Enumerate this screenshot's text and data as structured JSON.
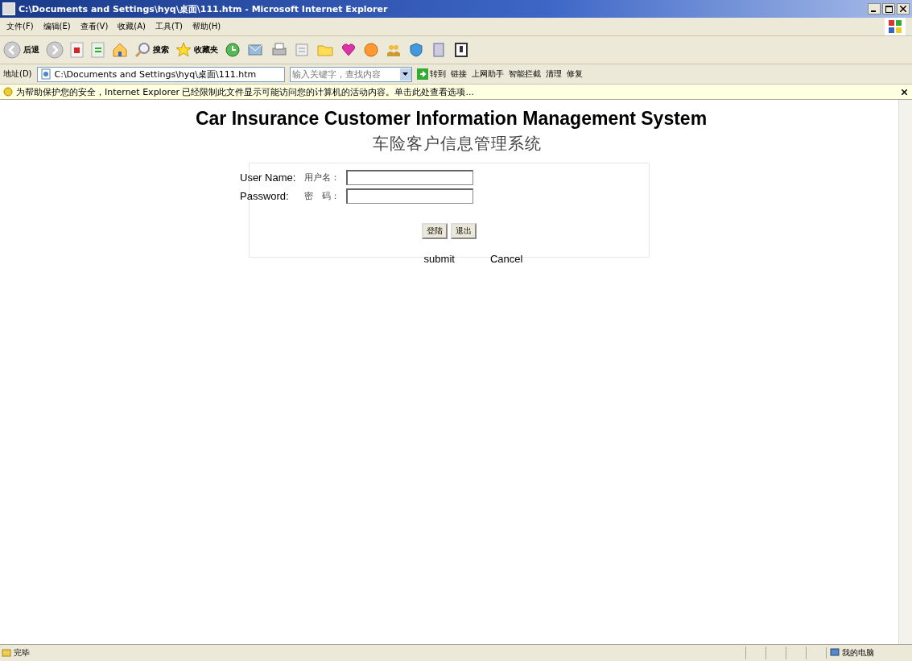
{
  "window": {
    "title": "C:\\Documents and Settings\\hyq\\桌面\\111.htm - Microsoft Internet Explorer"
  },
  "menu": [
    "文件(F)",
    "编辑(E)",
    "查看(V)",
    "收藏(A)",
    "工具(T)",
    "帮助(H)"
  ],
  "toolbar": {
    "back": "后退",
    "search": "搜索",
    "favorites": "收藏夹"
  },
  "address_bar": {
    "label": "地址(D)",
    "url": "C:\\Documents and Settings\\hyq\\桌面\\111.htm",
    "search_placeholder": "输入关键字，查找内容",
    "go": "转到",
    "links": "链接",
    "extras": [
      "上网助手",
      "智能拦截",
      "清理",
      "修复"
    ]
  },
  "info_bar": {
    "text": "为帮助保护您的安全，Internet Explorer 已经限制此文件显示可能访问您的计算机的活动内容。单击此处查看选项..."
  },
  "page": {
    "title": "Car Insurance Customer Information Management System",
    "subtitle": "车险客户信息管理系统",
    "fields": [
      {
        "label": "User Name:",
        "label_cn": "用户名："
      },
      {
        "label": "Password:",
        "label_cn": "密　码："
      }
    ],
    "buttons": [
      "登陆",
      "退出"
    ],
    "button_captions": [
      "submit",
      "Cancel"
    ]
  },
  "status_bar": {
    "text": "完毕",
    "zone": "我的电脑"
  }
}
